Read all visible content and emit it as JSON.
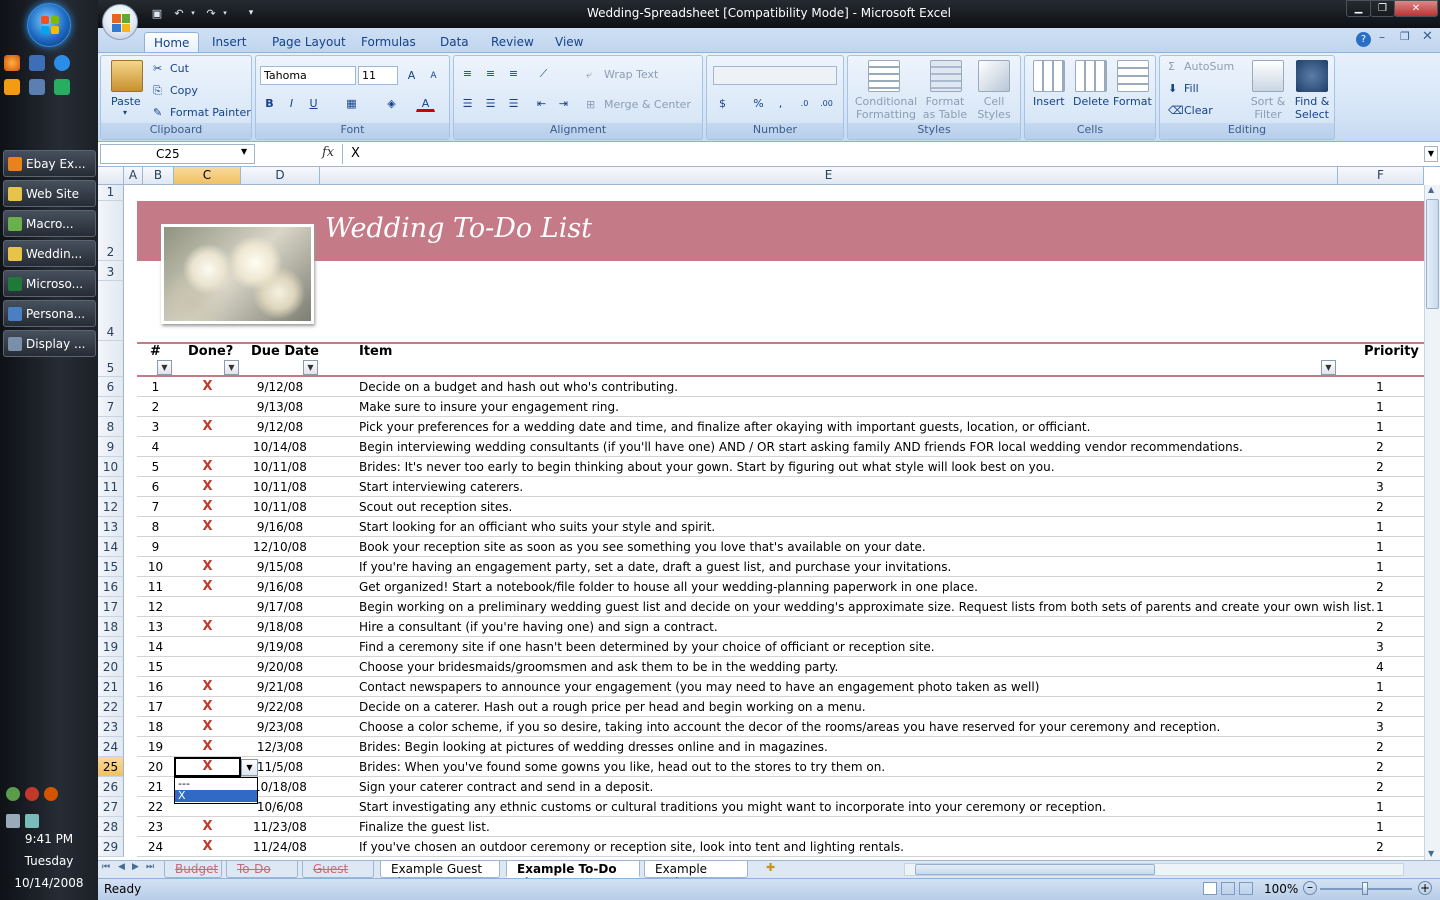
{
  "taskbar": {
    "buttons": [
      {
        "label": "Ebay Ex...",
        "color": "#e8821a"
      },
      {
        "label": "Web Site",
        "color": "#e7c34a"
      },
      {
        "label": "Macro...",
        "color": "#6ab04c"
      },
      {
        "label": "Weddin...",
        "color": "#e7c34a"
      },
      {
        "label": "Microso...",
        "color": "#1f7a3a"
      },
      {
        "label": "Persona...",
        "color": "#4a7fc4"
      },
      {
        "label": "Display ...",
        "color": "#7a8fa8"
      }
    ],
    "time": "9:41 PM",
    "day": "Tuesday",
    "date": "10/14/2008"
  },
  "window": {
    "title": "Wedding-Spreadsheet  [Compatibility Mode] - Microsoft Excel"
  },
  "ribbon": {
    "tabs": [
      "Home",
      "Insert",
      "Page Layout",
      "Formulas",
      "Data",
      "Review",
      "View"
    ],
    "active_tab": "Home",
    "clipboard": {
      "label": "Clipboard",
      "paste": "Paste",
      "cut": "Cut",
      "copy": "Copy",
      "format_painter": "Format Painter"
    },
    "font": {
      "label": "Font",
      "name": "Tahoma",
      "size": "11"
    },
    "alignment": {
      "label": "Alignment",
      "wrap": "Wrap Text",
      "merge": "Merge & Center"
    },
    "number": {
      "label": "Number",
      "format": ""
    },
    "styles": {
      "label": "Styles",
      "conditional": "Conditional Formatting",
      "format_table": "Format as Table",
      "cell_styles": "Cell Styles"
    },
    "cells": {
      "label": "Cells",
      "insert": "Insert",
      "delete": "Delete",
      "format": "Format"
    },
    "editing": {
      "label": "Editing",
      "autosum": "AutoSum",
      "fill": "Fill",
      "clear": "Clear",
      "sort": "Sort & Filter",
      "find": "Find & Select"
    }
  },
  "formula_bar": {
    "cell_ref": "C25",
    "fx": "fx",
    "value": "X"
  },
  "columns": [
    "A",
    "B",
    "C",
    "D",
    "E",
    "F"
  ],
  "sheet": {
    "title": "Wedding To-Do List",
    "headers": {
      "num": "#",
      "done": "Done?",
      "due": "Due Date",
      "item": "Item",
      "priority": "Priority"
    },
    "rows": [
      {
        "row": "6",
        "num": "1",
        "done": "X",
        "due": "9/12/08",
        "item": "Decide on a budget and hash out who's contributing.",
        "priority": "1"
      },
      {
        "row": "7",
        "num": "2",
        "done": "",
        "due": "9/13/08",
        "item": "Make sure to insure your engagement ring.",
        "priority": "1"
      },
      {
        "row": "8",
        "num": "3",
        "done": "X",
        "due": "9/12/08",
        "item": "Pick your preferences for a wedding date and time, and finalize after okaying with important guests, location, or officiant.",
        "priority": "1"
      },
      {
        "row": "9",
        "num": "4",
        "done": "",
        "due": "10/14/08",
        "item": "Begin interviewing wedding consultants (if you'll have one) AND / OR start asking family AND friends FOR local wedding vendor recommendations.",
        "priority": "2"
      },
      {
        "row": "10",
        "num": "5",
        "done": "X",
        "due": "10/11/08",
        "item": "Brides: It's never too early to begin thinking about your gown. Start by figuring out what style will look best on you.",
        "priority": "2"
      },
      {
        "row": "11",
        "num": "6",
        "done": "X",
        "due": "10/11/08",
        "item": "Start interviewing caterers.",
        "priority": "3"
      },
      {
        "row": "12",
        "num": "7",
        "done": "X",
        "due": "10/11/08",
        "item": "Scout out reception sites.",
        "priority": "2"
      },
      {
        "row": "13",
        "num": "8",
        "done": "X",
        "due": "9/16/08",
        "item": "Start looking for an officiant who suits your style and spirit.",
        "priority": "1"
      },
      {
        "row": "14",
        "num": "9",
        "done": "",
        "due": "12/10/08",
        "item": "Book your reception site as soon as you see something you love that's available on your date.",
        "priority": "1"
      },
      {
        "row": "15",
        "num": "10",
        "done": "X",
        "due": "9/15/08",
        "item": "If you're having an engagement party, set a date, draft a guest list, and purchase your invitations.",
        "priority": "1"
      },
      {
        "row": "16",
        "num": "11",
        "done": "X",
        "due": "9/16/08",
        "item": "Get organized! Start a notebook/file folder to house all your wedding-planning paperwork in one place.",
        "priority": "2"
      },
      {
        "row": "17",
        "num": "12",
        "done": "",
        "due": "9/17/08",
        "item": "Begin working on a preliminary wedding guest list and decide on your wedding's approximate size. Request lists from both sets of parents and create your own wish list.",
        "priority": "1"
      },
      {
        "row": "18",
        "num": "13",
        "done": "X",
        "due": "9/18/08",
        "item": "Hire a consultant (if you're having one) and sign a contract.",
        "priority": "2"
      },
      {
        "row": "19",
        "num": "14",
        "done": "",
        "due": "9/19/08",
        "item": "Find a ceremony site if one hasn't been determined by your choice of officiant or reception site.",
        "priority": "3"
      },
      {
        "row": "20",
        "num": "15",
        "done": "",
        "due": "9/20/08",
        "item": "Choose your bridesmaids/groomsmen and ask them to be in the wedding party.",
        "priority": "4"
      },
      {
        "row": "21",
        "num": "16",
        "done": "X",
        "due": "9/21/08",
        "item": "Contact newspapers to announce your engagement (you may need to have an engagement photo taken as well)",
        "priority": "1"
      },
      {
        "row": "22",
        "num": "17",
        "done": "X",
        "due": "9/22/08",
        "item": "Decide on a caterer. Hash out a rough price per head and begin working on a menu.",
        "priority": "2"
      },
      {
        "row": "23",
        "num": "18",
        "done": "X",
        "due": "9/23/08",
        "item": "Choose a color scheme, if you so desire, taking into account the decor of the rooms/areas you have reserved for your ceremony and reception.",
        "priority": "3"
      },
      {
        "row": "24",
        "num": "19",
        "done": "X",
        "due": "12/3/08",
        "item": "Brides: Begin looking at pictures of wedding dresses online and in magazines.",
        "priority": "2"
      },
      {
        "row": "25",
        "num": "20",
        "done": "X",
        "due": "11/5/08",
        "item": "Brides: When you've found some gowns you like, head out to the stores to try them on.",
        "priority": "2"
      },
      {
        "row": "26",
        "num": "21",
        "done": "",
        "due": "10/18/08",
        "item": "Sign your caterer contract and send in a deposit.",
        "priority": "2"
      },
      {
        "row": "27",
        "num": "22",
        "done": "",
        "due": "10/6/08",
        "item": "Start investigating any ethnic customs or cultural traditions you might want to incorporate into your ceremony or reception.",
        "priority": "1"
      },
      {
        "row": "28",
        "num": "23",
        "done": "X",
        "due": "11/23/08",
        "item": "Finalize the guest list.",
        "priority": "1"
      },
      {
        "row": "29",
        "num": "24",
        "done": "X",
        "due": "11/24/08",
        "item": "If you've chosen an outdoor ceremony or reception site, look into tent and lighting rentals.",
        "priority": "2"
      }
    ],
    "top_rows": [
      "1",
      "2",
      "3",
      "4",
      "5"
    ],
    "dropdown_options": [
      "---",
      "X"
    ]
  },
  "sheet_tabs": [
    {
      "label": "Budget",
      "state": "hidden"
    },
    {
      "label": "To-Do List",
      "state": "hidden"
    },
    {
      "label": "Guest List",
      "state": "hidden"
    },
    {
      "label": "Example Guest List",
      "state": "normal"
    },
    {
      "label": "Example To-Do List",
      "state": "active"
    },
    {
      "label": "Example Budget",
      "state": "normal"
    }
  ],
  "status": {
    "ready": "Ready",
    "zoom": "100%"
  }
}
